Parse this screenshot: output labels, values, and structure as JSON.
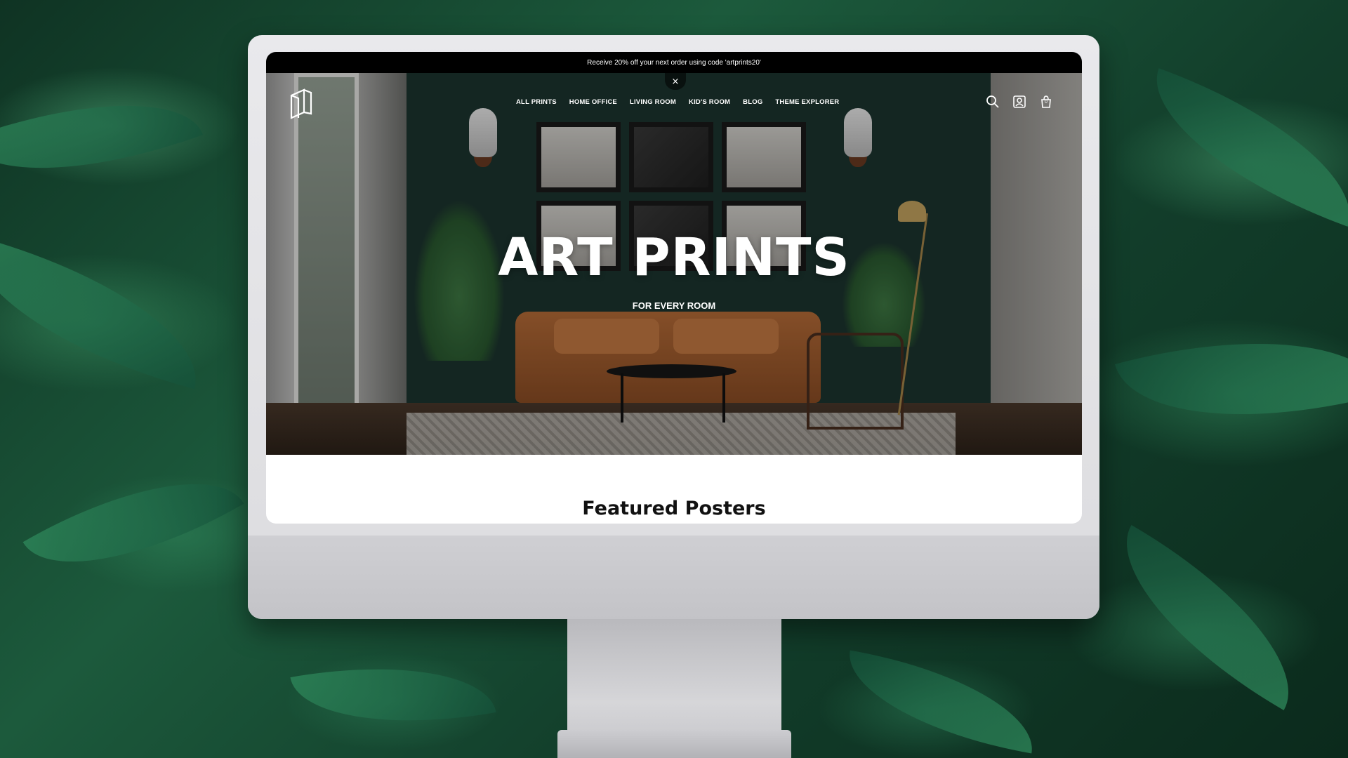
{
  "announcement": {
    "text": "Receive 20% off your next order using code 'artprints20'"
  },
  "close_button": {
    "glyph": "×"
  },
  "nav": {
    "items": [
      {
        "label": "ALL PRINTS"
      },
      {
        "label": "HOME OFFICE"
      },
      {
        "label": "LIVING ROOM"
      },
      {
        "label": "KID'S ROOM"
      },
      {
        "label": "BLOG"
      },
      {
        "label": "THEME EXPLORER"
      }
    ]
  },
  "header_icons": {
    "search": "search-icon",
    "account": "user-icon",
    "cart": "cart-icon",
    "cart_count": "0"
  },
  "hero": {
    "title": "ART PRINTS",
    "subtitle": "FOR EVERY ROOM"
  },
  "featured": {
    "heading": "Featured Posters"
  },
  "colors": {
    "announcement_bg": "#000000",
    "hero_text": "#ffffff",
    "heading_text": "#111111"
  }
}
